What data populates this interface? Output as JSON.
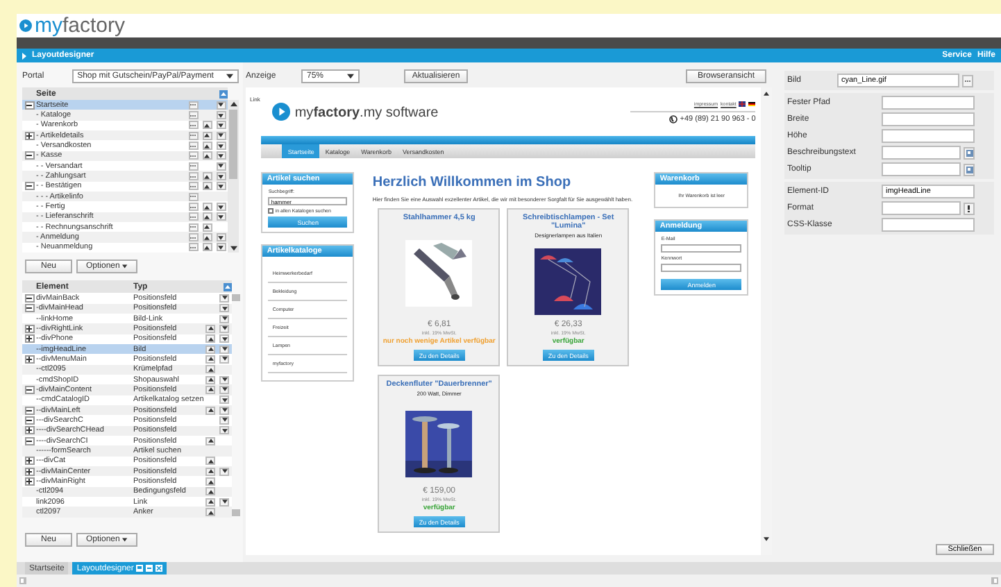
{
  "header": {
    "logo": [
      "my",
      "factory"
    ]
  },
  "title_bar": {
    "title": "Layoutdesigner",
    "links": [
      "Service",
      "Hilfe"
    ]
  },
  "left_panel": {
    "portal": {
      "label": "Portal",
      "value": "Shop mit Gutschein/PayPal/Payment"
    },
    "pages": {
      "column": "Seite",
      "items": [
        {
          "label": "Startseite",
          "selected": true,
          "expanded": true,
          "up": false,
          "down": true,
          "children": [
            {
              "label": "- Kataloge",
              "selected": false,
              "up": false,
              "down": true
            },
            {
              "label": "- Warenkorb",
              "selected": false,
              "up": true,
              "down": true
            },
            {
              "label": "- Artikeldetails",
              "selected": false,
              "expanded": false,
              "up": true,
              "down": true
            },
            {
              "label": "- Versandkosten",
              "selected": false,
              "up": true,
              "down": true
            },
            {
              "label": "- Kasse",
              "selected": false,
              "expanded": true,
              "up": true,
              "down": true,
              "children": [
                {
                  "label": "- - Versandart",
                  "selected": false,
                  "up": false,
                  "down": true
                },
                {
                  "label": "- - Zahlungsart",
                  "selected": false,
                  "up": true,
                  "down": true
                },
                {
                  "label": "- - Bestätigen",
                  "selected": false,
                  "expanded": true,
                  "up": true,
                  "down": true,
                  "children": [
                    {
                      "label": "- - - Artikelinfo",
                      "selected": false,
                      "up": false,
                      "down": false
                    }
                  ]
                },
                {
                  "label": "- - Fertig",
                  "selected": false,
                  "up": true,
                  "down": true
                },
                {
                  "label": "- - Lieferanschrift",
                  "selected": false,
                  "up": true,
                  "down": true
                },
                {
                  "label": "- - Rechnungsanschrift",
                  "selected": false,
                  "up": true,
                  "down": false
                }
              ]
            },
            {
              "label": "- Anmeldung",
              "selected": false,
              "up": true,
              "down": true
            },
            {
              "label": "- Neuanmeldung",
              "selected": false,
              "up": true,
              "down": true
            }
          ]
        }
      ]
    },
    "page_buttons": [
      "Neu",
      "Optionen"
    ],
    "elements": {
      "columns": [
        "Element",
        "Typ"
      ],
      "items": [
        {
          "label": "divMainBack",
          "type": "Positionsfeld",
          "selected": false,
          "expanded": true,
          "up": false,
          "down": true,
          "children": [
            {
              "label": "-divMainHead",
              "type": "Positionsfeld",
              "selected": false,
              "expanded": true,
              "up": false,
              "down": true,
              "children": [
                {
                  "label": "--linkHome",
                  "type": "Bild-Link",
                  "selected": false,
                  "up": false,
                  "down": true
                },
                {
                  "label": "--divRightLink",
                  "type": "Positionsfeld",
                  "selected": false,
                  "expanded": false,
                  "up": true,
                  "down": true
                },
                {
                  "label": "--divPhone",
                  "type": "Positionsfeld",
                  "selected": false,
                  "expanded": false,
                  "up": true,
                  "down": true
                },
                {
                  "label": "--imgHeadLine",
                  "type": "Bild",
                  "selected": true,
                  "up": true,
                  "down": true
                },
                {
                  "label": "--divMenuMain",
                  "type": "Positionsfeld",
                  "selected": false,
                  "expanded": false,
                  "up": true,
                  "down": true
                },
                {
                  "label": "--ctl2095",
                  "type": "Krümelpfad",
                  "selected": false,
                  "up": true,
                  "down": false
                }
              ]
            },
            {
              "label": "-cmdShopID",
              "type": "Shopauswahl",
              "selected": false,
              "up": true,
              "down": true
            },
            {
              "label": "-divMainContent",
              "type": "Positionsfeld",
              "selected": false,
              "expanded": true,
              "up": true,
              "down": true,
              "children": [
                {
                  "label": "--cmdCatalogID",
                  "type": "Artikelkatalog setzen",
                  "selected": false,
                  "up": false,
                  "down": true
                },
                {
                  "label": "--divMainLeft",
                  "type": "Positionsfeld",
                  "selected": false,
                  "expanded": true,
                  "up": true,
                  "down": true,
                  "children": [
                    {
                      "label": "---divSearchC",
                      "type": "Positionsfeld",
                      "selected": false,
                      "expanded": true,
                      "up": false,
                      "down": true,
                      "children": [
                        {
                          "label": "----divSearchCHead",
                          "type": "Positionsfeld",
                          "selected": false,
                          "expanded": false,
                          "up": false,
                          "down": true
                        },
                        {
                          "label": "----divSearchCI",
                          "type": "Positionsfeld",
                          "selected": false,
                          "expanded": true,
                          "up": true,
                          "down": false,
                          "children": [
                            {
                              "label": "------formSearch",
                              "type": "Artikel suchen",
                              "selected": false,
                              "up": false,
                              "down": false
                            }
                          ]
                        }
                      ]
                    },
                    {
                      "label": "---divCat",
                      "type": "Positionsfeld",
                      "selected": false,
                      "expanded": false,
                      "up": true,
                      "down": false
                    }
                  ]
                },
                {
                  "label": "--divMainCenter",
                  "type": "Positionsfeld",
                  "selected": false,
                  "expanded": false,
                  "up": true,
                  "down": true
                },
                {
                  "label": "--divMainRight",
                  "type": "Positionsfeld",
                  "selected": false,
                  "expanded": false,
                  "up": true,
                  "down": false
                }
              ]
            },
            {
              "label": "-ctl2094",
              "type": "Bedingungsfeld",
              "selected": false,
              "up": true,
              "down": false
            }
          ]
        },
        {
          "label": "link2096",
          "type": "Link",
          "selected": false,
          "up": true,
          "down": true
        },
        {
          "label": "ctl2097",
          "type": "Anker",
          "selected": false,
          "up": true,
          "down": false
        }
      ]
    },
    "element_buttons": [
      "Neu",
      "Optionen"
    ]
  },
  "center": {
    "display_label": "Anzeige",
    "zoom": "75%",
    "refresh": "Aktualisieren",
    "browser_view": "Browseransicht",
    "link_label": "Link",
    "preview": {
      "logo": "my**factory**.my software",
      "links": [
        "impressum",
        "kontakt"
      ],
      "phone": "+49 (89) 21 90 963 - 0",
      "nav": [
        {
          "label": "Startseite",
          "selected": true
        },
        {
          "label": "Kataloge",
          "selected": false
        },
        {
          "label": "Warenkorb",
          "selected": false
        },
        {
          "label": "Versandkosten",
          "selected": false
        }
      ],
      "search": {
        "title": "Artikel suchen",
        "label": "Suchbegriff:",
        "value": "hammer",
        "checkbox": "in allen Katalogen suchen",
        "checked": false,
        "button": "Suchen"
      },
      "catalogs": {
        "title": "Artikelkataloge",
        "items": [
          "Heimwerkerbedarf",
          "Bekleidung",
          "Computer",
          "Freizeit",
          "Lampen",
          "myfactory"
        ]
      },
      "welcome": {
        "title": "Herzlich Willkommen im Shop",
        "text": "Hier finden Sie eine Auswahl exzellenter Artikel, die wir mit besonderer Sorgfalt für Sie ausgewählt haben."
      },
      "products": [
        {
          "title": "Stahlhammer 4,5 kg",
          "price": "€ 6,81",
          "tax": "inkl. 19% MwSt.",
          "availability": "nur noch wenige Artikel verfügbar",
          "color": "#f0a030",
          "button": "Zu den Details"
        },
        {
          "title": "Schreibtischlampen - Set \"Lumina\"",
          "subtitle": "Designerlampen aus Italien",
          "price": "€ 26,33",
          "tax": "inkl. 19% MwSt.",
          "availability": "verfügbar",
          "color": "#3aa53a",
          "button": "Zu den Details"
        },
        {
          "title": "Deckenfluter \"Dauerbrenner\"",
          "subtitle": "200 Watt, Dimmer",
          "price": "€ 159,00",
          "tax": "inkl. 19% MwSt.",
          "availability": "verfügbar",
          "color": "#3aa53a",
          "button": "Zu den Details"
        }
      ],
      "cart": {
        "title": "Warenkorb",
        "text": "Ihr Warenkorb ist leer"
      },
      "login": {
        "title": "Anmeldung",
        "email": "E-Mail",
        "password": "Kennwort",
        "button": "Anmelden"
      }
    }
  },
  "properties": {
    "groups": [
      [
        {
          "label": "Bild",
          "value": "cyan_Line.gif",
          "kind": "browse"
        }
      ],
      [
        {
          "label": "Fester Pfad",
          "kind": "plain"
        },
        {
          "label": "Breite",
          "kind": "plain"
        },
        {
          "label": "Höhe",
          "kind": "plain"
        },
        {
          "label": "Beschreibungstext",
          "kind": "translate"
        },
        {
          "label": "Tooltip",
          "kind": "translate"
        }
      ],
      [
        {
          "label": "Element-ID",
          "value": "imgHeadLine",
          "kind": "plain"
        },
        {
          "label": "Format",
          "kind": "format"
        },
        {
          "label": "CSS-Klasse",
          "kind": "plain"
        }
      ]
    ],
    "close": "Schließen"
  },
  "taskbar": {
    "tabs": [
      {
        "label": "Startseite",
        "selected": false
      },
      {
        "label": "Layoutdesigner",
        "selected": true
      }
    ]
  }
}
